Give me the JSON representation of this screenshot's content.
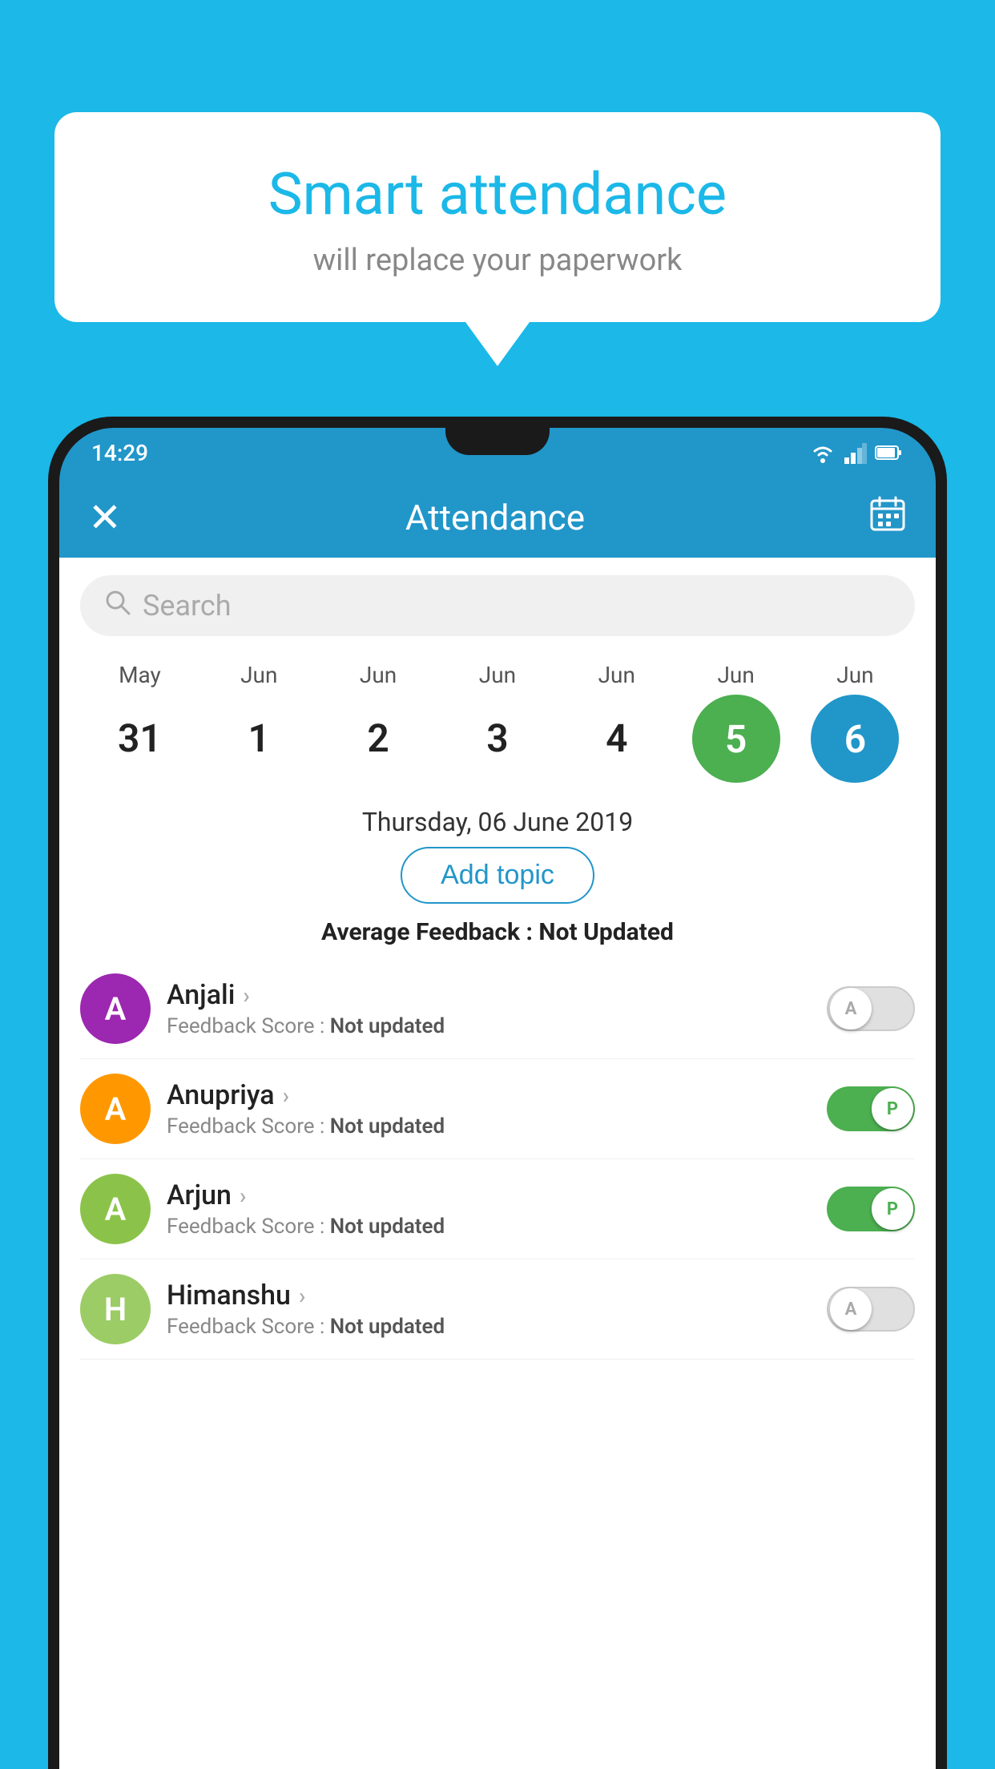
{
  "background_color": "#1BB8E8",
  "bubble": {
    "title": "Smart attendance",
    "subtitle": "will replace your paperwork"
  },
  "status_bar": {
    "time": "14:29",
    "wifi_icon": "wifi-icon",
    "signal_icon": "signal-icon",
    "battery_icon": "battery-icon"
  },
  "app_bar": {
    "close_icon": "×",
    "title": "Attendance",
    "calendar_icon": "calendar-icon"
  },
  "search": {
    "placeholder": "Search"
  },
  "calendar": {
    "dates": [
      {
        "month": "May",
        "day": "31",
        "highlight": "none"
      },
      {
        "month": "Jun",
        "day": "1",
        "highlight": "none"
      },
      {
        "month": "Jun",
        "day": "2",
        "highlight": "none"
      },
      {
        "month": "Jun",
        "day": "3",
        "highlight": "none"
      },
      {
        "month": "Jun",
        "day": "4",
        "highlight": "none"
      },
      {
        "month": "Jun",
        "day": "5",
        "highlight": "green"
      },
      {
        "month": "Jun",
        "day": "6",
        "highlight": "blue"
      }
    ]
  },
  "selected_date": "Thursday, 06 June 2019",
  "add_topic_label": "Add topic",
  "avg_feedback": {
    "label": "Average Feedback :",
    "value": "Not Updated"
  },
  "students": [
    {
      "name": "Anjali",
      "initial": "A",
      "avatar_color": "purple",
      "feedback_label": "Feedback Score :",
      "feedback_value": "Not updated",
      "toggle_state": "off",
      "toggle_label": "A"
    },
    {
      "name": "Anupriya",
      "initial": "A",
      "avatar_color": "orange",
      "feedback_label": "Feedback Score :",
      "feedback_value": "Not updated",
      "toggle_state": "on",
      "toggle_label": "P"
    },
    {
      "name": "Arjun",
      "initial": "A",
      "avatar_color": "light-green",
      "feedback_label": "Feedback Score :",
      "feedback_value": "Not updated",
      "toggle_state": "on",
      "toggle_label": "P"
    },
    {
      "name": "Himanshu",
      "initial": "H",
      "avatar_color": "olive",
      "feedback_label": "Feedback Score :",
      "feedback_value": "Not updated",
      "toggle_state": "off",
      "toggle_label": "A"
    }
  ]
}
